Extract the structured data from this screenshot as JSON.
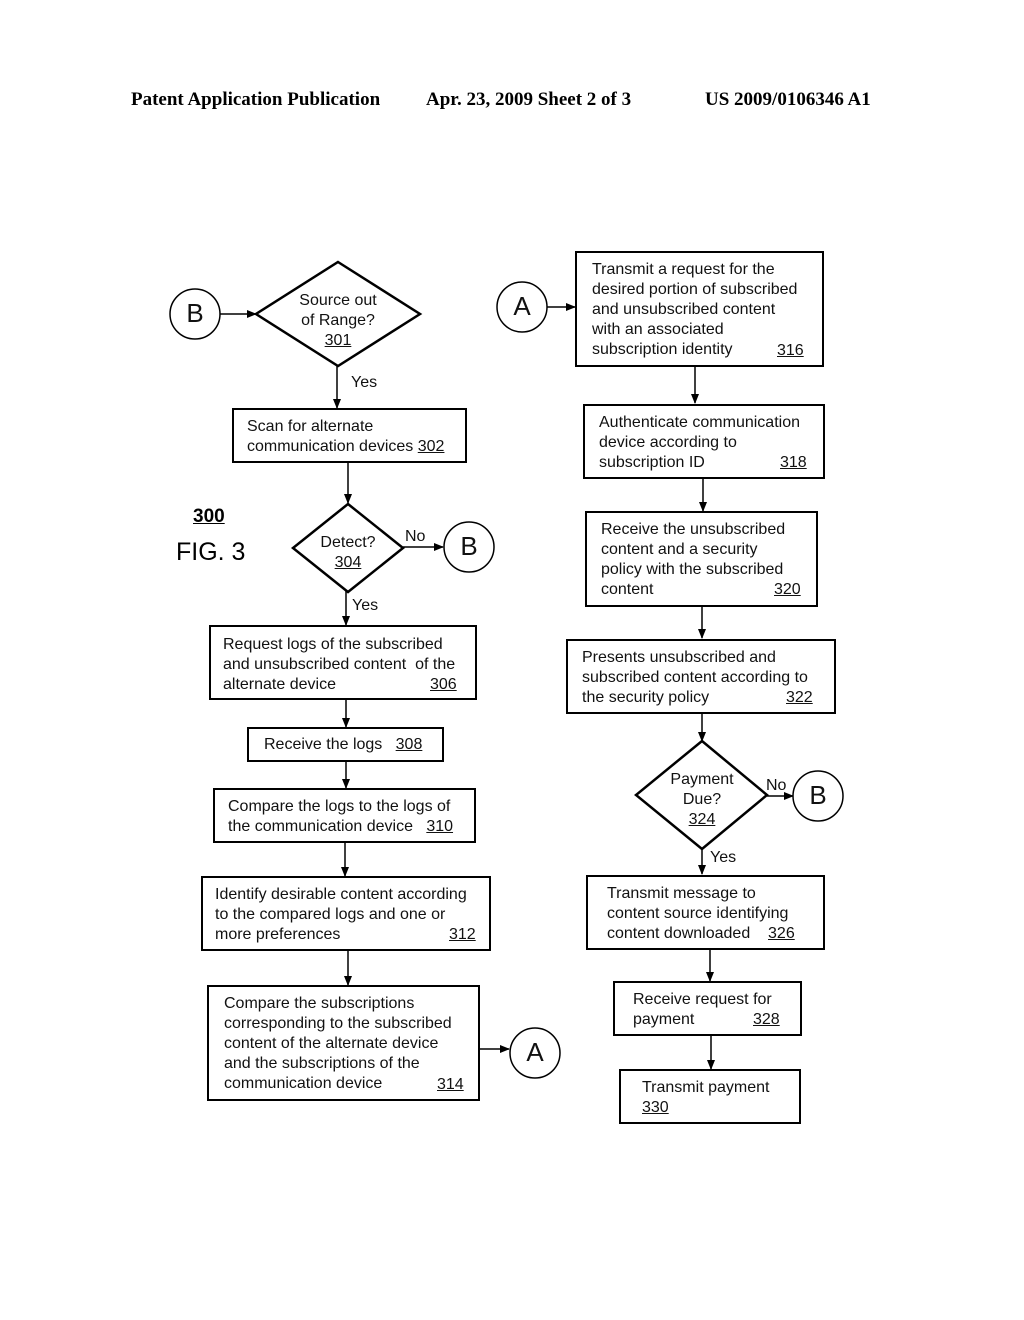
{
  "header": {
    "publication": "Patent Application Publication",
    "date_sheet": "Apr. 23, 2009  Sheet 2 of 3",
    "number": "US 2009/0106346 A1"
  },
  "figure": {
    "ref": "300",
    "label": "FIG. 3"
  },
  "connectors": {
    "A": "A",
    "B": "B"
  },
  "edge_labels": {
    "yes": "Yes",
    "no": "No"
  },
  "steps": {
    "s301": {
      "text_lines": [
        "Source out",
        "of Range?"
      ],
      "ref": "301"
    },
    "s302": {
      "text_lines": [
        "Scan for alternate",
        "communication devices"
      ],
      "ref": "302"
    },
    "s304": {
      "text_lines": [
        "Detect?"
      ],
      "ref": "304"
    },
    "s306": {
      "text_lines": [
        "Request logs of the subscribed",
        "and unsubscribed content  of the",
        "alternate device"
      ],
      "ref": "306"
    },
    "s308": {
      "text_lines": [
        "Receive the logs"
      ],
      "ref": "308"
    },
    "s310": {
      "text_lines": [
        "Compare the logs to the logs of",
        "the communication device"
      ],
      "ref": "310"
    },
    "s312": {
      "text_lines": [
        "Identify desirable content according",
        "to the compared logs and one or",
        "more preferences"
      ],
      "ref": "312"
    },
    "s314": {
      "text_lines": [
        "Compare the subscriptions",
        "corresponding to the subscribed",
        "content of the alternate device",
        "and the subscriptions of the",
        "communication device"
      ],
      "ref": "314"
    },
    "s316": {
      "text_lines": [
        "Transmit a request for the",
        "desired portion of subscribed",
        "and unsubscribed content",
        "with an associated",
        "subscription identity"
      ],
      "ref": "316"
    },
    "s318": {
      "text_lines": [
        "Authenticate communication",
        "device according to",
        "subscription ID"
      ],
      "ref": "318"
    },
    "s320": {
      "text_lines": [
        "Receive the unsubscribed",
        "content and a security",
        "policy with the subscribed",
        "content"
      ],
      "ref": "320"
    },
    "s322": {
      "text_lines": [
        "Presents unsubscribed and",
        "subscribed content according to",
        "the security policy"
      ],
      "ref": "322"
    },
    "s324": {
      "text_lines": [
        "Payment",
        "Due?"
      ],
      "ref": "324"
    },
    "s326": {
      "text_lines": [
        "Transmit message to",
        "content source identifying",
        "content downloaded"
      ],
      "ref": "326"
    },
    "s328": {
      "text_lines": [
        "Receive request for",
        "payment"
      ],
      "ref": "328"
    },
    "s330": {
      "text_lines": [
        "Transmit payment"
      ],
      "ref": "330"
    }
  }
}
